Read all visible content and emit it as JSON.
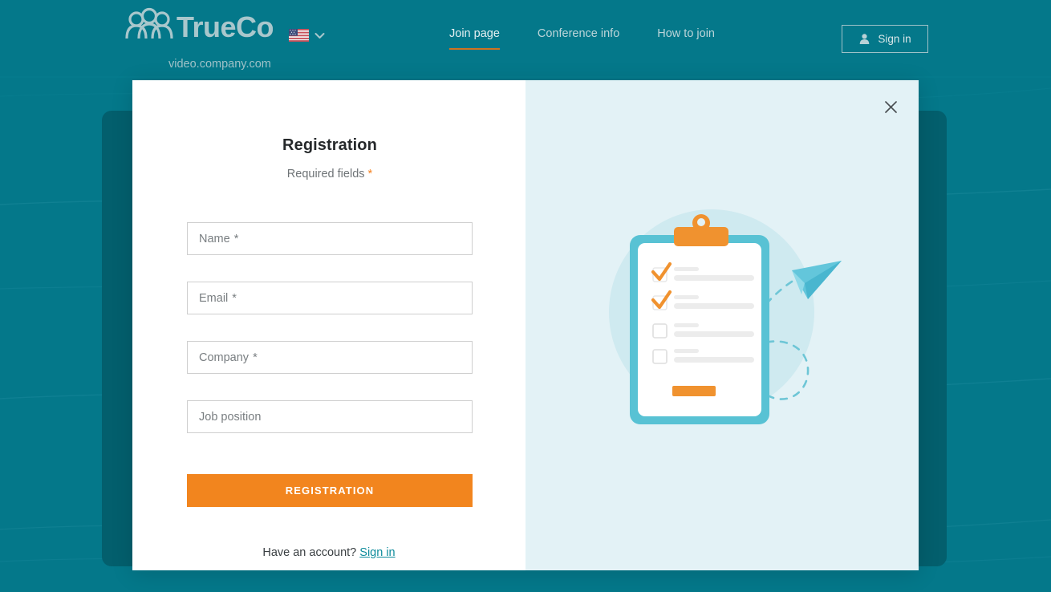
{
  "header": {
    "brand_name": "TrueConf",
    "domain": "video.company.com",
    "language": {
      "name": "English (US)",
      "flag_icon": "us-flag-icon",
      "chevron_icon": "chevron-down-icon"
    },
    "nav": [
      {
        "label": "Join page",
        "active": true
      },
      {
        "label": "Conference info",
        "active": false
      },
      {
        "label": "How to join",
        "active": false
      }
    ],
    "signin": {
      "label": "Sign in",
      "icon": "person-icon"
    }
  },
  "modal": {
    "close_icon": "close-icon",
    "title": "Registration",
    "required_note_text": "Required fields",
    "required_marker": "*",
    "fields": [
      {
        "placeholder": "Name",
        "required": true,
        "value": ""
      },
      {
        "placeholder": "Email",
        "required": true,
        "value": ""
      },
      {
        "placeholder": "Company",
        "required": true,
        "value": ""
      },
      {
        "placeholder": "Job position",
        "required": false,
        "value": ""
      }
    ],
    "submit_label": "REGISTRATION",
    "footer_text": "Have an account?",
    "footer_link": "Sign in",
    "illustration": "clipboard-checklist-paper-plane-illustration"
  },
  "colors": {
    "page_bg": "#04788a",
    "panel_bg": "#035f6d",
    "accent_orange": "#f2851e",
    "accent_teal": "#0d8b9b",
    "illustration_bg": "#e3f2f6",
    "clipboard_border": "#58c2d4"
  }
}
